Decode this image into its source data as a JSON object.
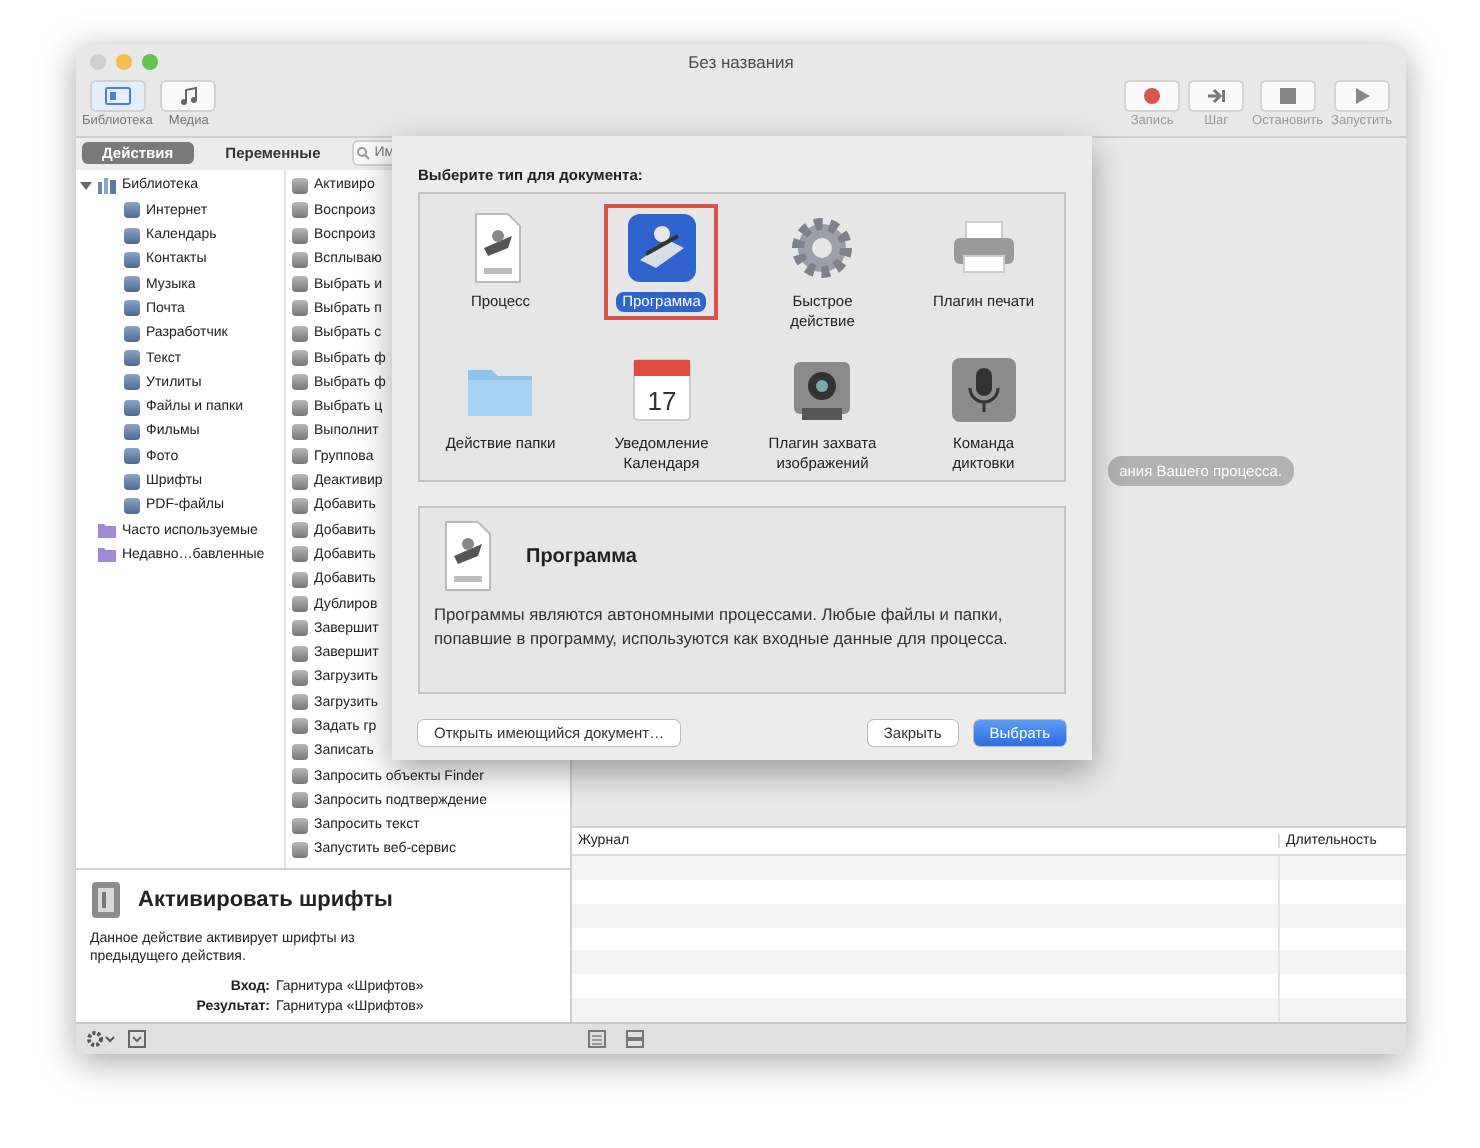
{
  "window": {
    "title": "Без названия"
  },
  "toolbar": {
    "left": [
      {
        "label": "Библиотека",
        "kind": "library",
        "selected": true
      },
      {
        "label": "Медиа",
        "kind": "media",
        "selected": false
      }
    ],
    "right": [
      {
        "label": "Запись",
        "kind": "record",
        "disabled": true
      },
      {
        "label": "Шаг",
        "kind": "step",
        "disabled": true
      },
      {
        "label": "Остановить",
        "kind": "stop",
        "disabled": true
      },
      {
        "label": "Запустить",
        "kind": "run",
        "disabled": true
      }
    ]
  },
  "tabs": [
    {
      "label": "Действия",
      "selected": true
    },
    {
      "label": "Переменные",
      "selected": false
    }
  ],
  "search": {
    "placeholder": "Им"
  },
  "sidebar": {
    "items": [
      {
        "label": "Библиотека",
        "kind": "library",
        "expanded": true,
        "children": [
          {
            "label": "Интернет"
          },
          {
            "label": "Календарь"
          },
          {
            "label": "Контакты"
          },
          {
            "label": "Музыка"
          },
          {
            "label": "Почта"
          },
          {
            "label": "Разработчик"
          },
          {
            "label": "Текст"
          },
          {
            "label": "Утилиты"
          },
          {
            "label": "Файлы и папки"
          },
          {
            "label": "Фильмы"
          },
          {
            "label": "Фото"
          },
          {
            "label": "Шрифты"
          },
          {
            "label": "PDF-файлы"
          }
        ]
      },
      {
        "label": "Часто используемые",
        "kind": "smart-folder"
      },
      {
        "label": "Недавно…бавленные",
        "kind": "smart-folder"
      }
    ]
  },
  "actions": [
    "Активиро",
    "Воспроиз",
    "Воспроиз",
    "Всплываю",
    "Выбрать и",
    "Выбрать п",
    "Выбрать с",
    "Выбрать ф",
    "Выбрать ф",
    "Выбрать ц",
    "Выполнит",
    "Группова",
    "Деактивир",
    "Добавить",
    "Добавить",
    "Добавить",
    "Добавить",
    "Дублиров",
    "Завершит",
    "Завершит",
    "Загрузить",
    "Загрузить",
    "Задать гр",
    "Записать",
    "Запросить объекты Finder",
    "Запросить подтверждение",
    "Запросить текст",
    "Запустить веб-сервис"
  ],
  "description": {
    "title": "Активировать шрифты",
    "text": "Данное действие активирует шрифты из предыдущего действия.",
    "fields": [
      {
        "label": "Вход:",
        "value": "Гарнитура «Шрифтов»"
      },
      {
        "label": "Результат:",
        "value": "Гарнитура «Шрифтов»"
      }
    ]
  },
  "workflow": {
    "hint": "ания Вашего процесса."
  },
  "log": {
    "columns": [
      "Журнал",
      "Длительность"
    ]
  },
  "dialog": {
    "prompt": "Выберите тип для документа:",
    "types": [
      {
        "label": "Процесс",
        "kind": "workflow",
        "selected": false
      },
      {
        "label": "Программа",
        "kind": "app",
        "selected": true
      },
      {
        "label": "Быстрое\nдействие",
        "kind": "gear",
        "selected": false
      },
      {
        "label": "Плагин печати",
        "kind": "printer",
        "selected": false
      },
      {
        "label": "Действие папки",
        "kind": "folder",
        "selected": false
      },
      {
        "label": "Уведомление\nКалендаря",
        "kind": "calendar",
        "badge": "17",
        "selected": false
      },
      {
        "label": "Плагин захвата\nизображений",
        "kind": "camera",
        "selected": false
      },
      {
        "label": "Команда\nдиктовки",
        "kind": "mic",
        "selected": false
      }
    ],
    "detail": {
      "title": "Программа",
      "kind": "app",
      "text": "Программы являются автономными процессами. Любые файлы и папки, попавшие в программу, используются как входные данные для процесса."
    },
    "buttons": [
      {
        "label": "Открыть имеющийся документ…",
        "kind": "secondary"
      },
      {
        "label": "Закрыть",
        "kind": "secondary"
      },
      {
        "label": "Выбрать",
        "kind": "default"
      }
    ]
  }
}
